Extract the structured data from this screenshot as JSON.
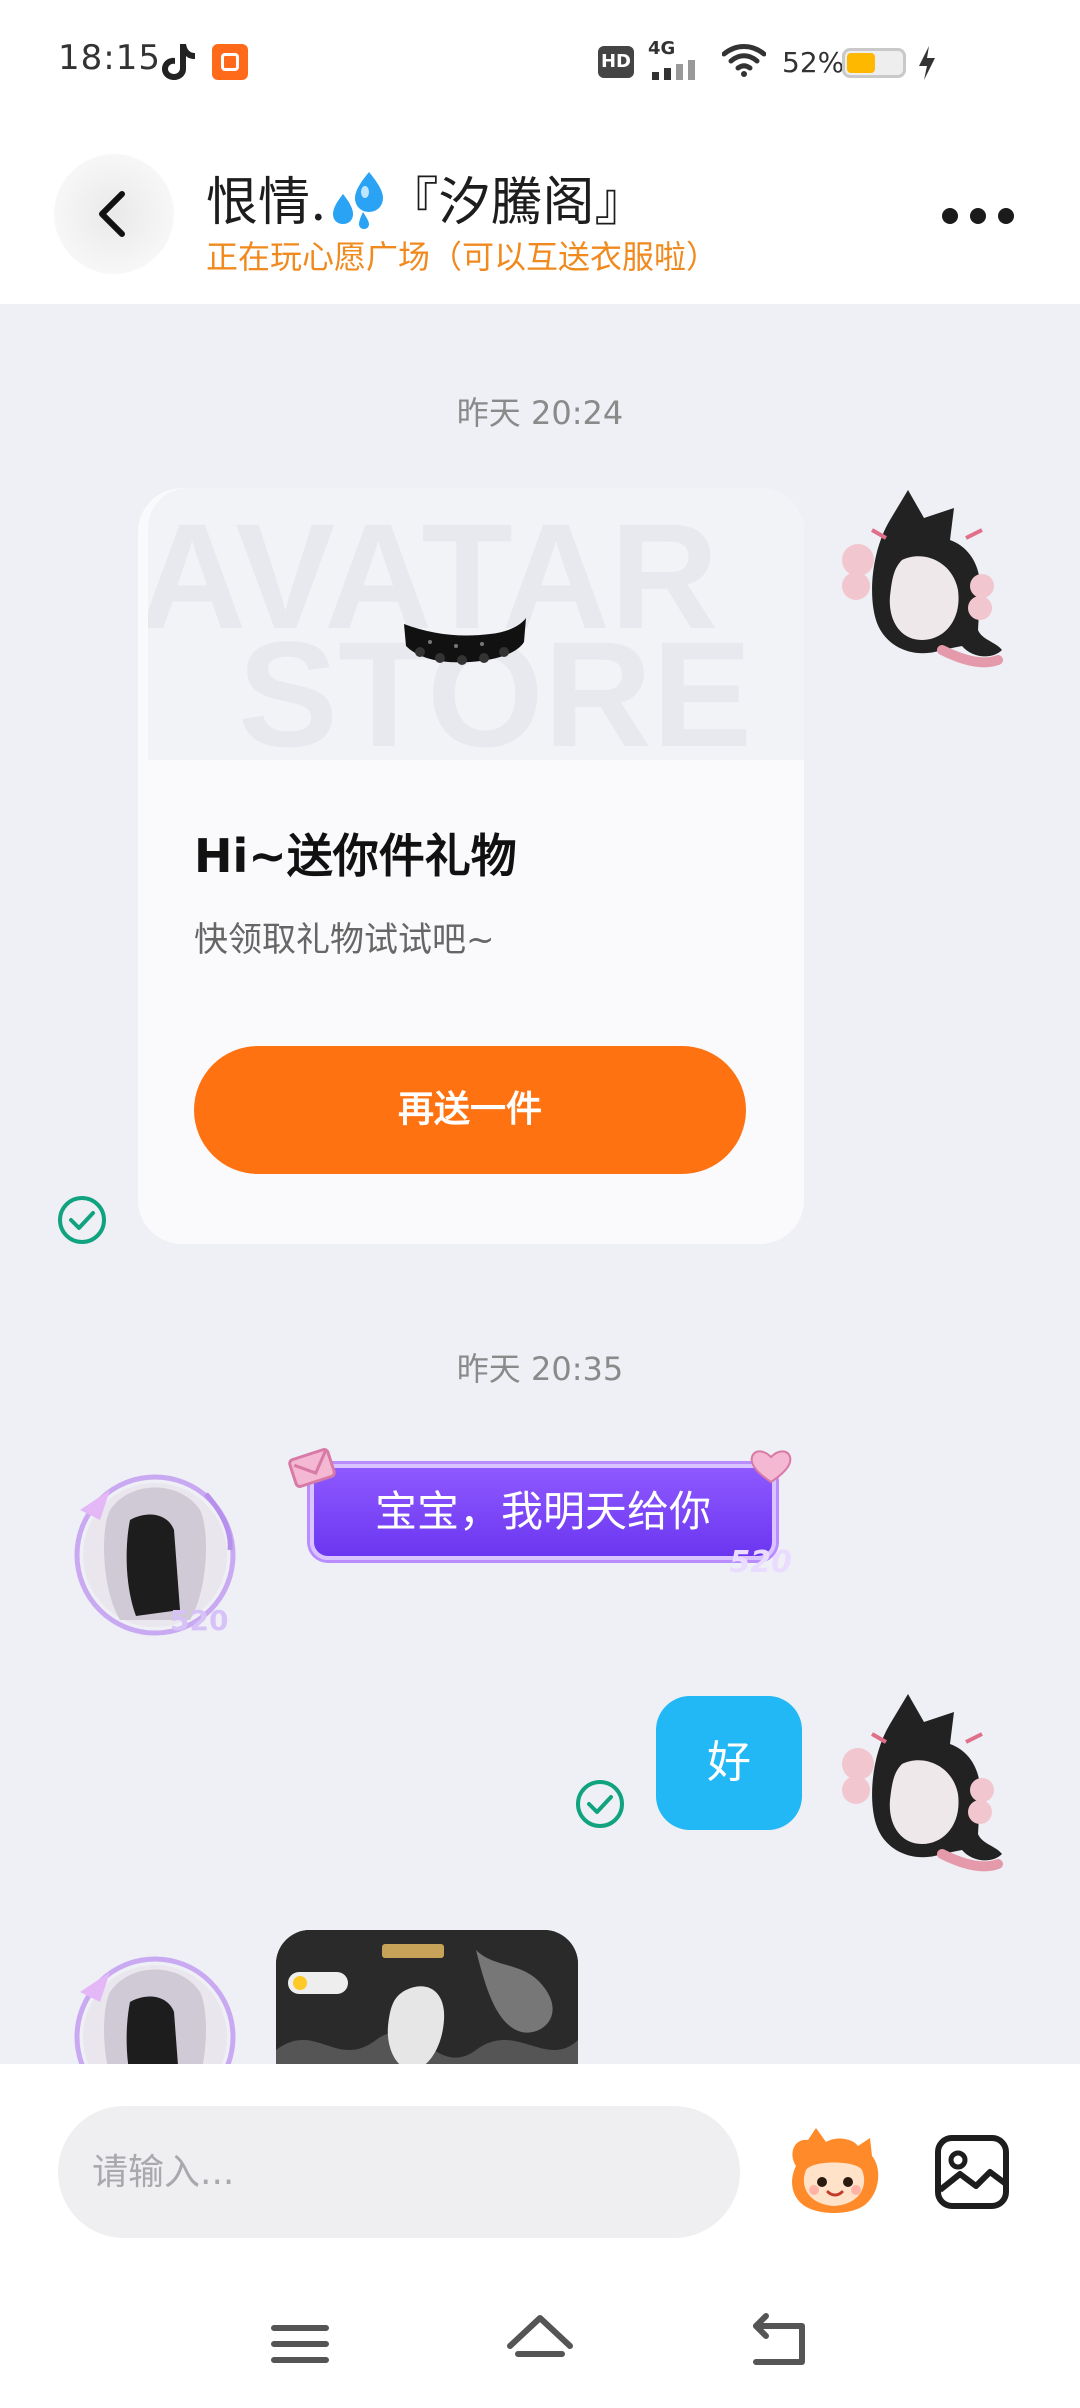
{
  "status_bar": {
    "time": "18:15",
    "network": "4G",
    "hd_label": "HD",
    "battery_percent_text": "52%",
    "battery_level": 0.52,
    "icons": [
      "tiktok-icon",
      "app-notification-icon",
      "hd-icon",
      "signal-icon",
      "wifi-icon",
      "battery-icon",
      "charging-icon"
    ]
  },
  "header": {
    "title": "恨情.",
    "title_suffix": "『汐騰阁』",
    "status": "正在玩心愿广场（可以互送衣服啦）",
    "status_color": "#f08a1e"
  },
  "messages": {
    "timestamp_1": "昨天 20:24",
    "gift": {
      "title": "Hi~送你件礼物",
      "description": "快领取礼物试试吧~",
      "button": "再送一件",
      "watermark_line1": "AVATAR",
      "watermark_line2": "STORE"
    },
    "timestamp_2": "昨天 20:35",
    "incoming_text": "宝宝，我明天给你",
    "bubble_tag": "520",
    "outgoing_text": "好"
  },
  "input": {
    "placeholder": "请输入..."
  },
  "colors": {
    "accent_orange": "#fe7212",
    "self_bubble": "#22b7f5",
    "read_check": "#11a37f",
    "purple_bubble": "#7a44f6"
  }
}
